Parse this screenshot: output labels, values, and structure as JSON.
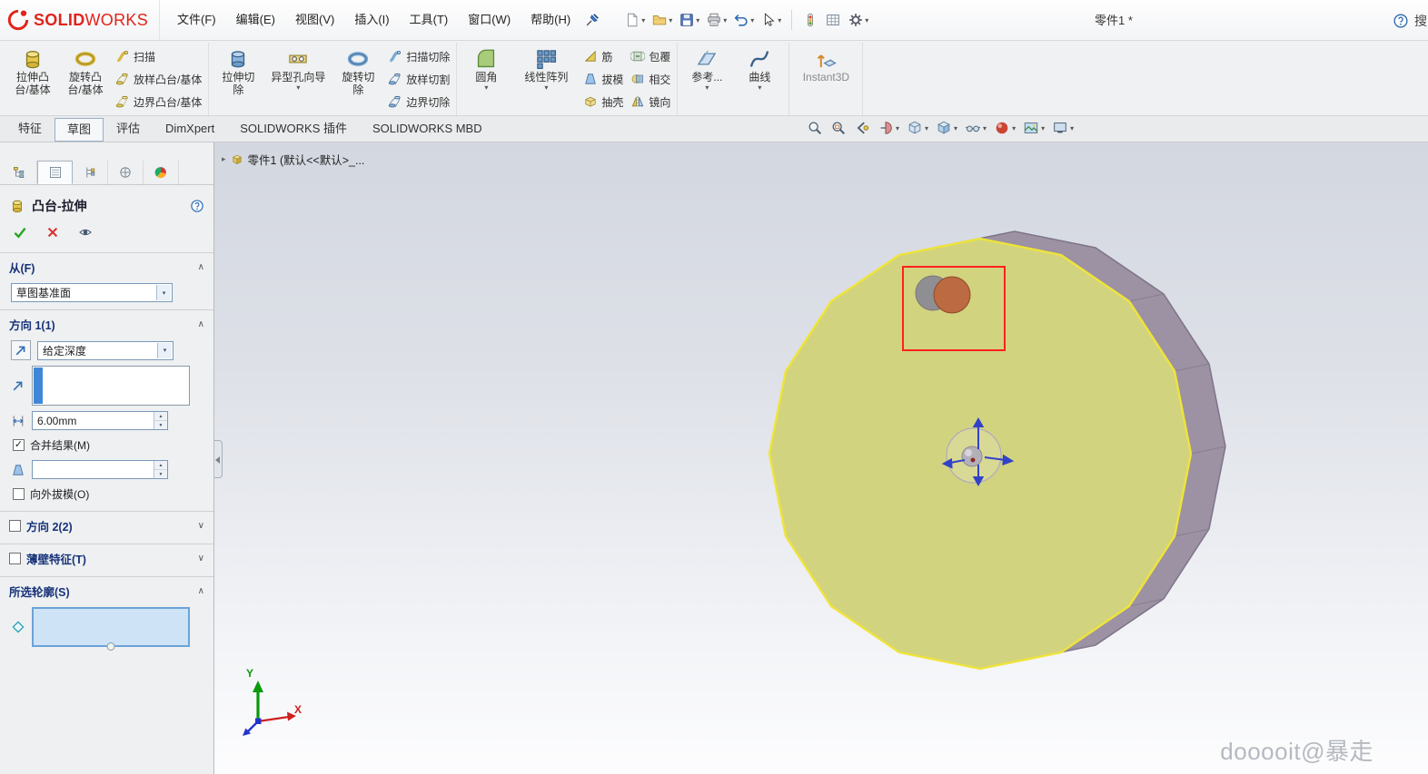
{
  "icons": {
    "caret": "▾",
    "chev_up": "∧",
    "chev_down": "∨",
    "check": "✓",
    "expand": "▸",
    "spin_up": "▲",
    "spin_down": "▼"
  },
  "menubar": {
    "logo_bold": "SOLID",
    "logo_light": "WORKS",
    "menus": [
      "文件(F)",
      "编辑(E)",
      "视图(V)",
      "插入(I)",
      "工具(T)",
      "窗口(W)",
      "帮助(H)"
    ],
    "doc_title": "零件1 *",
    "search_clip": "搜"
  },
  "ribbon": {
    "b_extrude_boss": [
      "拉伸凸",
      "台/基体"
    ],
    "b_revolve_boss": [
      "旋转凸",
      "台/基体"
    ],
    "s_sweep": "扫描",
    "s_loft": "放样凸台/基体",
    "s_boundary": "边界凸台/基体",
    "b_extrude_cut": [
      "拉伸切",
      "除"
    ],
    "b_hole_wizard": [
      "异型孔向导"
    ],
    "b_revolve_cut": [
      "旋转切",
      "除"
    ],
    "s_sweep_cut": "扫描切除",
    "s_loft_cut": "放样切割",
    "s_boundary_cut": "边界切除",
    "b_fillet": [
      "圆角"
    ],
    "b_pattern": [
      "线性阵列"
    ],
    "s_rib": "筋",
    "s_draft": "拔模",
    "s_shell": "抽壳",
    "s_wrap": "包覆",
    "s_intersect": "相交",
    "s_mirror": "镜向",
    "b_reference": [
      "参考..."
    ],
    "b_curve": [
      "曲线"
    ],
    "b_instant3d": [
      "Instant3D"
    ]
  },
  "tabbar": {
    "tabs": [
      "特征",
      "草图",
      "评估",
      "DimXpert",
      "SOLIDWORKS 插件",
      "SOLIDWORKS MBD"
    ]
  },
  "pm": {
    "title": "凸台-拉伸",
    "from_header": "从(F)",
    "from_value": "草图基准面",
    "dir1_header": "方向 1(1)",
    "dir1_end": "给定深度",
    "dir1_depth": "6.00mm",
    "dir1_merge": "合并结果(M)",
    "dir1_outward": "向外拔模(O)",
    "dir2_header": "方向 2(2)",
    "thin_header": "薄壁特征(T)",
    "contours_header": "所选轮廓(S)"
  },
  "viewport": {
    "tree_root": "零件1 (默认<<默认>_...",
    "watermark": "dooooit@暴走",
    "axis_x": "X",
    "axis_y": "Y"
  },
  "colors": {
    "face_yellow": "#d2d37f",
    "edge_yellow": "#efe43a",
    "side_gray": "#9c92a3",
    "selection_red": "#ff2020",
    "logo_red": "#e2231a"
  }
}
